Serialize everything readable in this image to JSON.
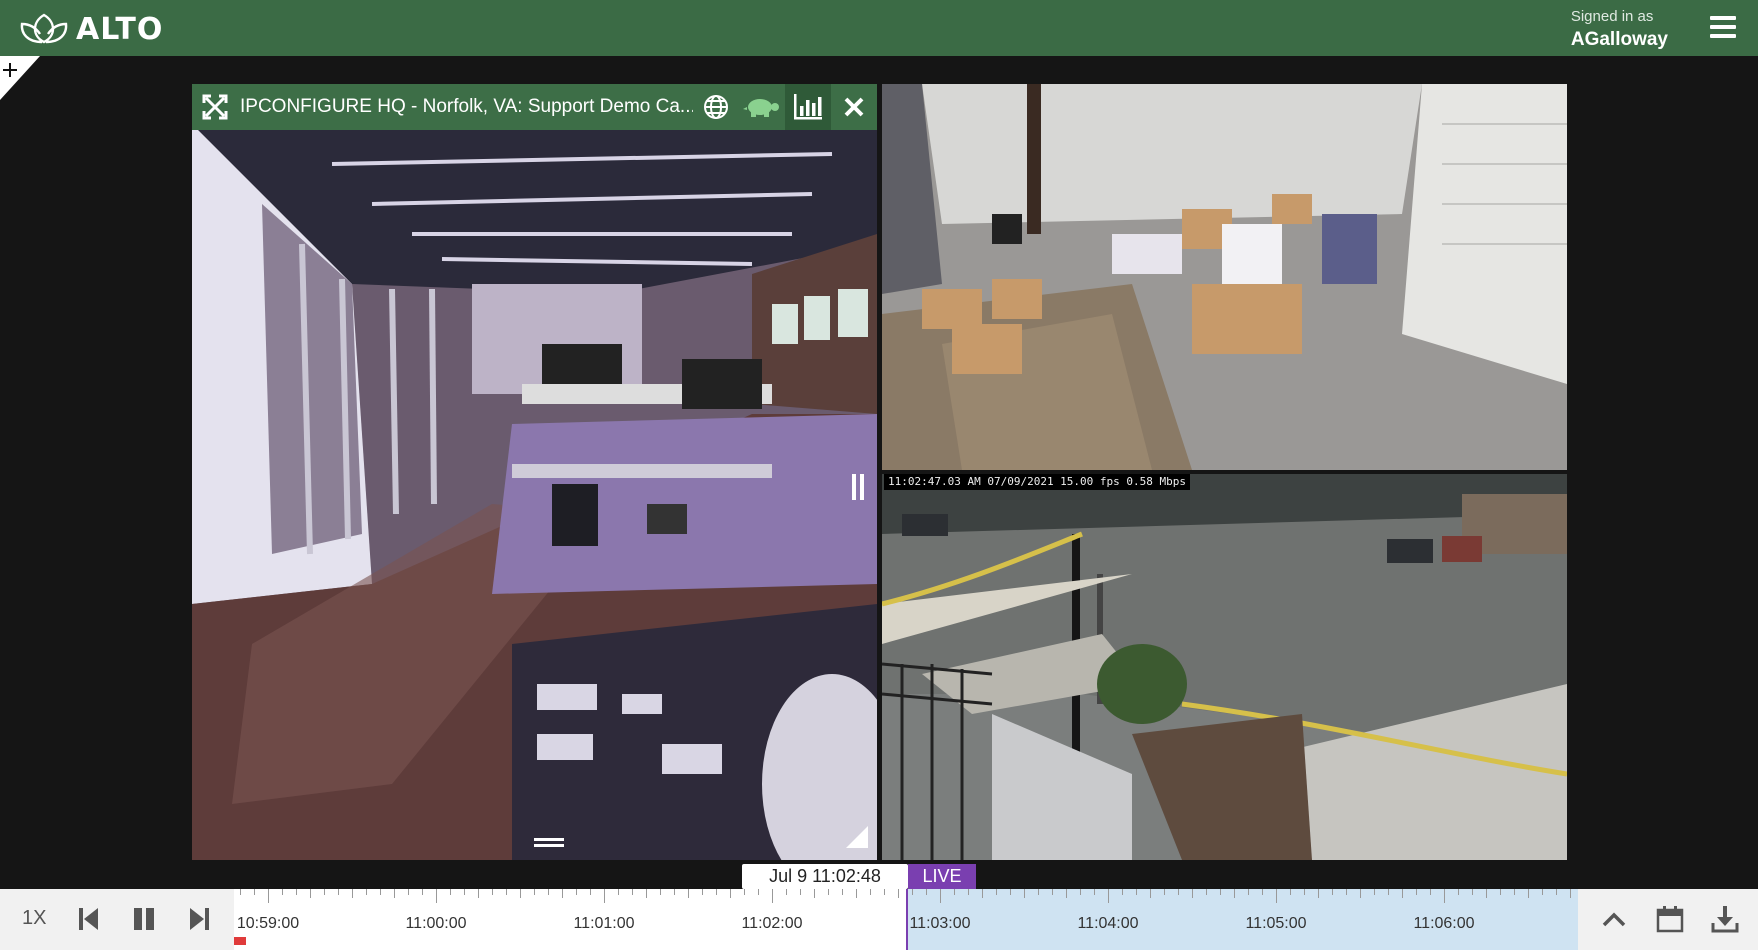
{
  "app": {
    "brand": "ALTO",
    "signed_in_label": "Signed in as",
    "user": "AGalloway",
    "accent_color": "#3b6b45",
    "live_color": "#7a3fb0"
  },
  "camera": {
    "title": "IPCONFIGURE HQ - Norfolk, VA: Support Demo Ca...",
    "icons": [
      "expand-icon",
      "globe-icon",
      "turtle-icon",
      "bar-chart-icon",
      "close-icon"
    ]
  },
  "overlay": {
    "osd_text": "11:02:47.03 AM 07/09/2021 15.00 fps  0.58 Mbps"
  },
  "playback": {
    "current_time": "Jul 9 11:02:48",
    "live_label": "LIVE",
    "speed": "1X"
  },
  "timeline": {
    "labels": [
      "10:59:00",
      "11:00:00",
      "11:01:00",
      "11:02:00",
      "11:03:00",
      "11:04:00",
      "11:05:00",
      "11:06:00"
    ]
  }
}
